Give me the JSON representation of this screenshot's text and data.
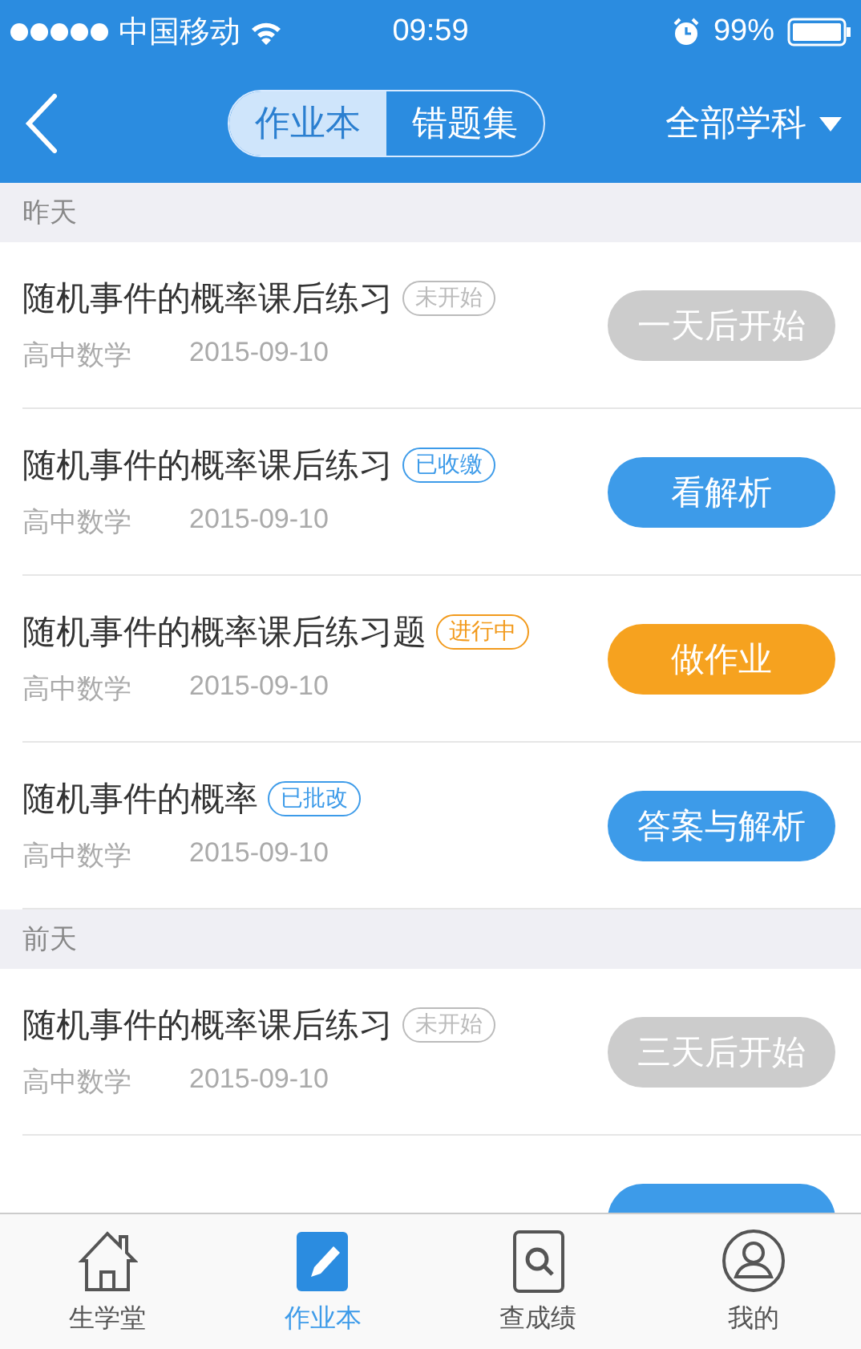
{
  "status_bar": {
    "carrier": "中国移动",
    "time": "09:59",
    "battery": "99%"
  },
  "nav": {
    "segments": [
      {
        "label": "作业本",
        "selected": true
      },
      {
        "label": "错题集",
        "selected": false
      }
    ],
    "filter": "全部学科"
  },
  "sections": [
    {
      "title": "昨天",
      "items": [
        {
          "title": "随机事件的概率课后练习",
          "status": {
            "label": "未开始",
            "kind": "pending"
          },
          "subject": "高中数学",
          "date": "2015-09-10",
          "action": {
            "label": "一天后开始",
            "kind": "pending"
          }
        },
        {
          "title": "随机事件的概率课后练习",
          "status": {
            "label": "已收缴",
            "kind": "done"
          },
          "subject": "高中数学",
          "date": "2015-09-10",
          "action": {
            "label": "看解析",
            "kind": "done"
          }
        },
        {
          "title": "随机事件的概率课后练习题",
          "status": {
            "label": "进行中",
            "kind": "active"
          },
          "subject": "高中数学",
          "date": "2015-09-10",
          "action": {
            "label": "做作业",
            "kind": "active"
          }
        },
        {
          "title": "随机事件的概率",
          "status": {
            "label": "已批改",
            "kind": "done"
          },
          "subject": "高中数学",
          "date": "2015-09-10",
          "action": {
            "label": "答案与解析",
            "kind": "done"
          }
        }
      ]
    },
    {
      "title": "前天",
      "items": [
        {
          "title": "随机事件的概率课后练习",
          "status": {
            "label": "未开始",
            "kind": "pending"
          },
          "subject": "高中数学",
          "date": "2015-09-10",
          "action": {
            "label": "三天后开始",
            "kind": "pending"
          }
        },
        {
          "action": {
            "kind": "done"
          }
        }
      ]
    }
  ],
  "tab_bar": [
    {
      "label": "生学堂",
      "kind": "home",
      "selected": false
    },
    {
      "label": "作业本",
      "kind": "pencil",
      "selected": true
    },
    {
      "label": "查成绩",
      "kind": "search",
      "selected": false
    },
    {
      "label": "我的",
      "kind": "user",
      "selected": false
    }
  ]
}
